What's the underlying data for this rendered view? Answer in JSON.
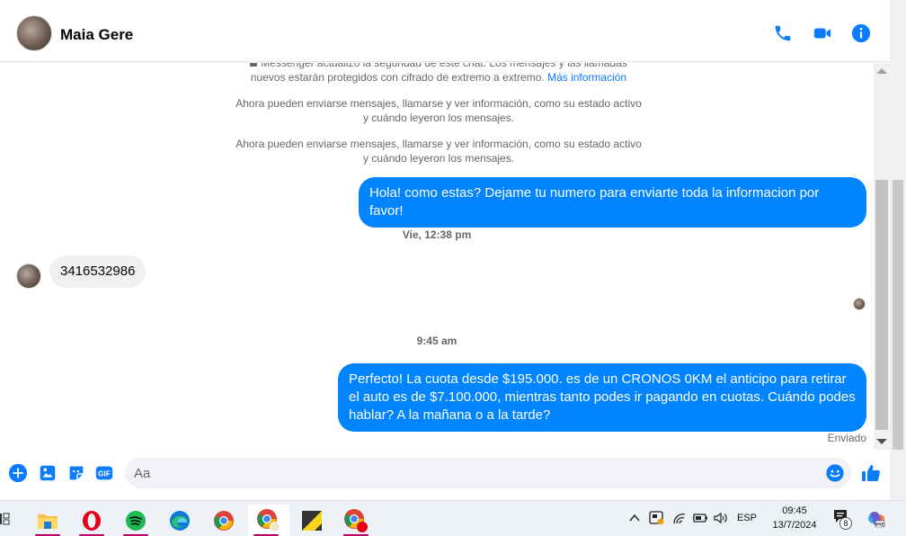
{
  "header": {
    "contact_name": "Maia Gere"
  },
  "messages": {
    "system_1_text": "Messenger actualizó la seguridad de este chat. Los mensajes y las llamadas nuevos estarán protegidos con cifrado de extremo a extremo.",
    "system_1_link": "Más información",
    "system_2": "Ahora pueden enviarse mensajes, llamarse y ver información, como su estado activo y cuándo leyeron los mensajes.",
    "system_3": "Ahora pueden enviarse mensajes, llamarse y ver información, como su estado activo y cuándo leyeron los mensajes.",
    "outgoing_1": "Hola! como estas? Dejame tu numero para enviarte toda la informacion por favor!",
    "timestamp_1": "Vie, 12:38 pm",
    "incoming_1": "3416532986",
    "timestamp_2": "9:45 am",
    "outgoing_2": "Perfecto! La cuota desde $195.000. es de un CRONOS 0KM el anticipo para retirar el auto es de $7.100.000, mientras tanto podes ir pagando en cuotas. Cuándo podes hablar? A la mañana o a la tarde?",
    "status": "Enviado"
  },
  "composer": {
    "placeholder": "Aa"
  },
  "taskbar": {
    "language": "ESP",
    "time": "09:45",
    "date": "13/7/2024",
    "notification_count": "8"
  },
  "colors": {
    "messenger_blue": "#0084ff",
    "icon_blue": "#0a7cff",
    "taskbar_accent": "#c4006a"
  }
}
